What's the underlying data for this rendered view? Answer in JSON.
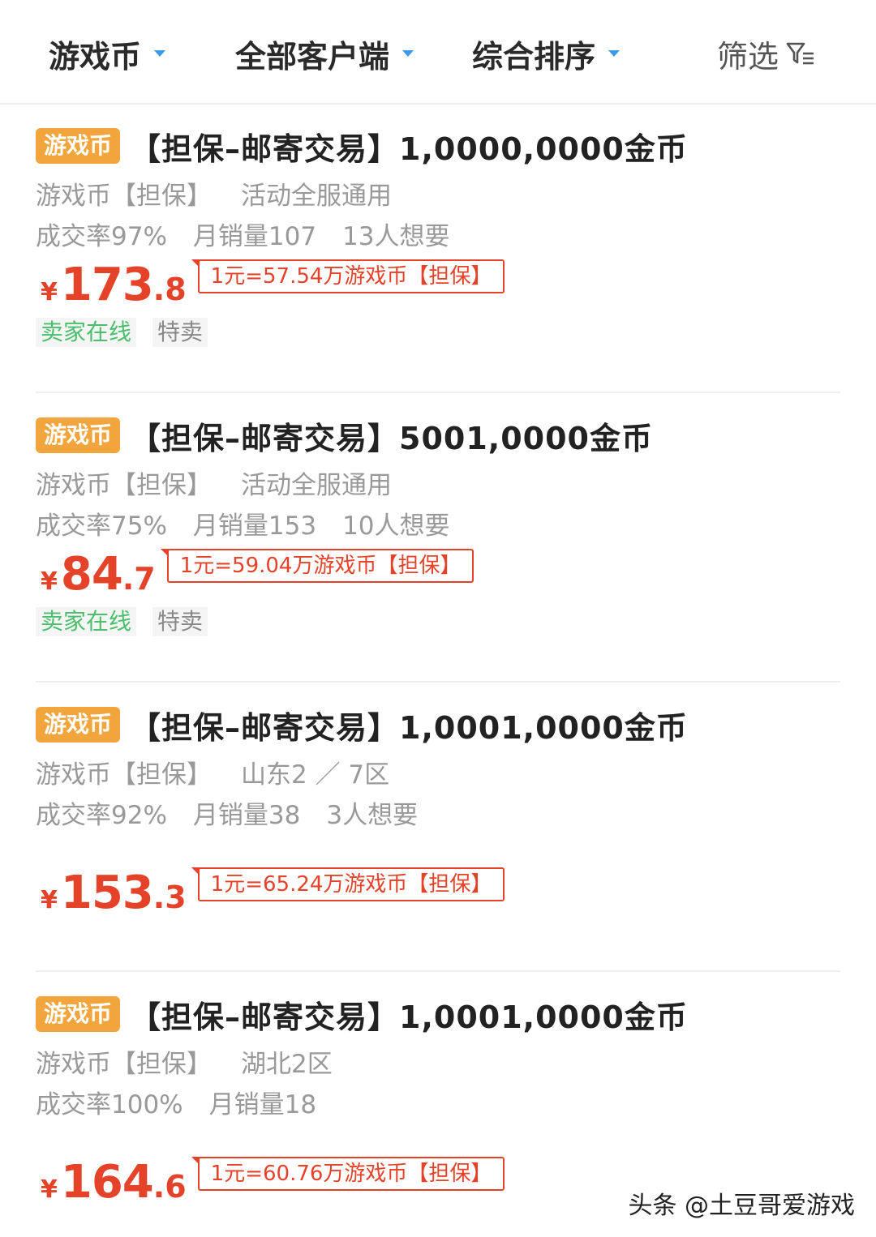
{
  "filter_bar": {
    "game_currency": "游戏币",
    "all_clients": "全部客户端",
    "sort": "综合排序",
    "filter": "筛选"
  },
  "colors": {
    "accent_blue": "#3e9ae8",
    "price_red": "#e4432a",
    "badge_orange": "#f2a53c",
    "online_green": "#4bbf6b"
  },
  "listings": [
    {
      "badge": "游戏币",
      "title": "【担保–邮寄交易】1,0000,0000金币",
      "type": "游戏币【担保】",
      "server": "活动全服通用",
      "deal_rate": "成交率97%",
      "monthly_sales": "月销量107",
      "wants": "13人想要",
      "yen": "¥",
      "price_int": "173",
      "price_dec": ".8",
      "rate": "1元=57.54万游戏币【担保】",
      "tag_online": "卖家在线",
      "tag_special": "特卖"
    },
    {
      "badge": "游戏币",
      "title": "【担保–邮寄交易】5001,0000金币",
      "type": "游戏币【担保】",
      "server": "活动全服通用",
      "deal_rate": "成交率75%",
      "monthly_sales": "月销量153",
      "wants": "10人想要",
      "yen": "¥",
      "price_int": "84",
      "price_dec": ".7",
      "rate": "1元=59.04万游戏币【担保】",
      "tag_online": "卖家在线",
      "tag_special": "特卖"
    },
    {
      "badge": "游戏币",
      "title": "【担保–邮寄交易】1,0001,0000金币",
      "type": "游戏币【担保】",
      "server": "山东2 ／ 7区",
      "deal_rate": "成交率92%",
      "monthly_sales": "月销量38",
      "wants": "3人想要",
      "yen": "¥",
      "price_int": "153",
      "price_dec": ".3",
      "rate": "1元=65.24万游戏币【担保】"
    },
    {
      "badge": "游戏币",
      "title": "【担保–邮寄交易】1,0001,0000金币",
      "type": "游戏币【担保】",
      "server": "湖北2区",
      "deal_rate": "成交率100%",
      "monthly_sales": "月销量18",
      "yen": "¥",
      "price_int": "164",
      "price_dec": ".6",
      "rate": "1元=60.76万游戏币【担保】"
    }
  ],
  "watermark": "头条 @土豆哥爱游戏"
}
